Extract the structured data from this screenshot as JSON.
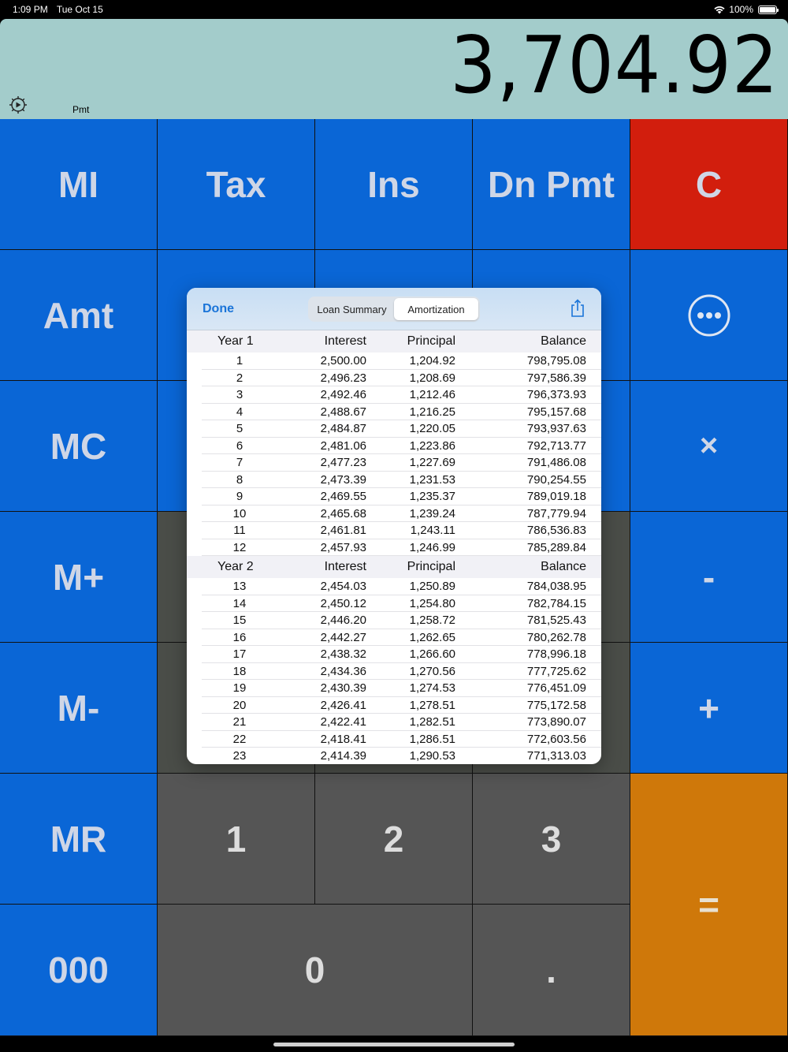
{
  "status": {
    "time": "1:09 PM",
    "date": "Tue Oct 15",
    "battery": "100%"
  },
  "display": {
    "value": "3,704.92",
    "mode": "Pmt"
  },
  "colors": {
    "blue": "#0a66d6",
    "red": "#d21e0d",
    "grey": "#555555",
    "orange": "#cf780a",
    "display_bg": "#a3cccb"
  },
  "keys": {
    "mi": "MI",
    "tax": "Tax",
    "ins": "Ins",
    "dn_pmt": "Dn Pmt",
    "clear": "C",
    "amt": "Amt",
    "mc": "MC",
    "m_plus": "M+",
    "m_minus": "M-",
    "mr": "MR",
    "triple_zero": "000",
    "multiply": "×",
    "minus": "-",
    "plus": "+",
    "equals": "=",
    "one": "1",
    "two": "2",
    "three": "3",
    "zero": "0",
    "decimal": "."
  },
  "popover": {
    "done": "Done",
    "tabs": [
      {
        "label": "Loan Summary"
      },
      {
        "label": "Amortization"
      }
    ],
    "active_tab": "Amortization",
    "columns": [
      "Interest",
      "Principal",
      "Balance"
    ],
    "groups": [
      {
        "year": "Year 1",
        "rows": [
          [
            "1",
            "2,500.00",
            "1,204.92",
            "798,795.08"
          ],
          [
            "2",
            "2,496.23",
            "1,208.69",
            "797,586.39"
          ],
          [
            "3",
            "2,492.46",
            "1,212.46",
            "796,373.93"
          ],
          [
            "4",
            "2,488.67",
            "1,216.25",
            "795,157.68"
          ],
          [
            "5",
            "2,484.87",
            "1,220.05",
            "793,937.63"
          ],
          [
            "6",
            "2,481.06",
            "1,223.86",
            "792,713.77"
          ],
          [
            "7",
            "2,477.23",
            "1,227.69",
            "791,486.08"
          ],
          [
            "8",
            "2,473.39",
            "1,231.53",
            "790,254.55"
          ],
          [
            "9",
            "2,469.55",
            "1,235.37",
            "789,019.18"
          ],
          [
            "10",
            "2,465.68",
            "1,239.24",
            "787,779.94"
          ],
          [
            "11",
            "2,461.81",
            "1,243.11",
            "786,536.83"
          ],
          [
            "12",
            "2,457.93",
            "1,246.99",
            "785,289.84"
          ]
        ]
      },
      {
        "year": "Year 2",
        "rows": [
          [
            "13",
            "2,454.03",
            "1,250.89",
            "784,038.95"
          ],
          [
            "14",
            "2,450.12",
            "1,254.80",
            "782,784.15"
          ],
          [
            "15",
            "2,446.20",
            "1,258.72",
            "781,525.43"
          ],
          [
            "16",
            "2,442.27",
            "1,262.65",
            "780,262.78"
          ],
          [
            "17",
            "2,438.32",
            "1,266.60",
            "778,996.18"
          ],
          [
            "18",
            "2,434.36",
            "1,270.56",
            "777,725.62"
          ],
          [
            "19",
            "2,430.39",
            "1,274.53",
            "776,451.09"
          ],
          [
            "20",
            "2,426.41",
            "1,278.51",
            "775,172.58"
          ],
          [
            "21",
            "2,422.41",
            "1,282.51",
            "773,890.07"
          ],
          [
            "22",
            "2,418.41",
            "1,286.51",
            "772,603.56"
          ],
          [
            "23",
            "2,414.39",
            "1,290.53",
            "771,313.03"
          ]
        ]
      }
    ]
  }
}
